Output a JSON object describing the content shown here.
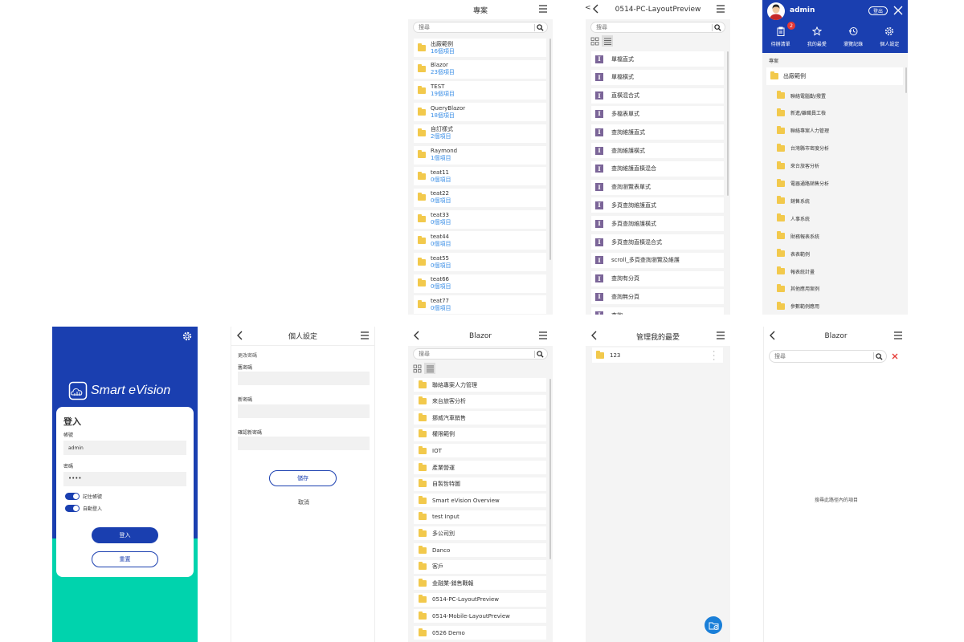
{
  "projects_panel": {
    "title": "專案",
    "search_placeholder": "搜尋",
    "items": [
      {
        "name": "出廠範例",
        "count": "16個項目"
      },
      {
        "name": "Blazor",
        "count": "23個項目"
      },
      {
        "name": "TEST",
        "count": "19個項目"
      },
      {
        "name": "QueryBlazor",
        "count": "18個項目"
      },
      {
        "name": "自訂樣式",
        "count": "2個項目"
      },
      {
        "name": "Raymond",
        "count": "1個項目"
      },
      {
        "name": "teat11",
        "count": "0個項目"
      },
      {
        "name": "teat22",
        "count": "0個項目"
      },
      {
        "name": "teat33",
        "count": "0個項目"
      },
      {
        "name": "teat44",
        "count": "0個項目"
      },
      {
        "name": "teat55",
        "count": "0個項目"
      },
      {
        "name": "teat66",
        "count": "0個項目"
      },
      {
        "name": "teat77",
        "count": "0個項目"
      }
    ]
  },
  "layout_panel": {
    "title": "0514-PC-LayoutPreview",
    "search_placeholder": "搜尋",
    "items": [
      "單檔直式",
      "單檔橫式",
      "直橫混合式",
      "多檔表單式",
      "查詢維護直式",
      "查詢維護橫式",
      "查詢維護直橫混合",
      "查詢瀏覽表單式",
      "多頁查詢維護直式",
      "多頁查詢維護橫式",
      "多頁查詢直橫混合式",
      "scroll_多頁查詢瀏覽及維護",
      "查詢有分頁",
      "查詢無分頁",
      "查詢..."
    ]
  },
  "menu_panel": {
    "username": "admin",
    "logout": "登出",
    "badge": "2",
    "tabs": [
      "待辦清單",
      "我的最愛",
      "瀏覽記錄",
      "個人設定"
    ],
    "section": "專案",
    "root": "出廠範例",
    "items": [
      "聯絡電腦勤/撥置",
      "新進/離職員工檢",
      "聯絡專案人力管理",
      "台灣縣市密度分析",
      "來台旅客分析",
      "電器通路銷售分析",
      "銷售系統",
      "人事系統",
      "財務報表系統",
      "表表範例",
      "報表統計畫",
      "其他應用案例",
      "參數範例應用"
    ]
  },
  "login_panel": {
    "brand": "Smart eVision",
    "heading": "登入",
    "account_label": "帳號",
    "account_value": "admin",
    "password_label": "密碼",
    "password_value": "••••",
    "remember": "記住帳號",
    "auto_login": "自動登入",
    "login_button": "登入",
    "reset_button": "重置"
  },
  "settings_panel": {
    "title": "個人設定",
    "section": "更改密碼",
    "old_pw": "舊密碼",
    "new_pw": "新密碼",
    "confirm_pw": "確認新密碼",
    "save": "儲存",
    "cancel": "取消"
  },
  "blazor_panel": {
    "title": "Blazor",
    "search_placeholder": "搜尋",
    "items": [
      "聯絡專案人力管理",
      "來台旅客分析",
      "挪威汽車銷售",
      "權限範例",
      "IOT",
      "產業營運",
      "自製哲特圖",
      "Smart eVision Overview",
      "test Input",
      "多公司別",
      "Danco",
      "客戶",
      "金融業-銷售戰報",
      "0514-PC-LayoutPreview",
      "0514-Mobile-LayoutPreview",
      "0526 Demo"
    ]
  },
  "favorites_panel": {
    "title": "管理我的最愛",
    "item": "123"
  },
  "search_panel": {
    "title": "Blazor",
    "search_placeholder": "搜尋",
    "empty_text": "搜尋此路徑內的項目"
  },
  "colors": {
    "primary": "#1a3fb0",
    "teal": "#00d3ad",
    "folder": "#f2c94c",
    "link": "#3a8ee6"
  }
}
